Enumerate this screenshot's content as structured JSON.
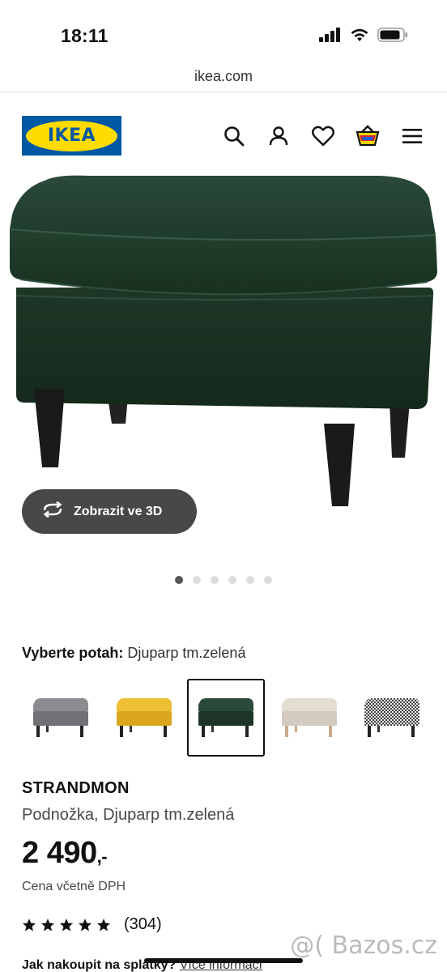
{
  "status_bar": {
    "time": "18:11",
    "icons": [
      "signal-icon",
      "wifi-icon",
      "battery-icon"
    ]
  },
  "browser": {
    "url": "ikea.com"
  },
  "header": {
    "logo_text": "IKEA",
    "icons": [
      "search-icon",
      "account-icon",
      "heart-icon",
      "cart-icon",
      "menu-icon"
    ]
  },
  "hero": {
    "view3d_label": "Zobrazit ve 3D",
    "dots_total": 6,
    "active_dot": 1
  },
  "fabric": {
    "label": "Vyberte potah:",
    "value": "Djuparp tm.zelená",
    "swatch_colors": [
      "#7d7f82",
      "#e7b52a",
      "#1f3a2c",
      "#ddd5c8",
      "#bdbdbd"
    ],
    "selected_index": 2
  },
  "product": {
    "name": "STRANDMON",
    "description": "Podnožka, Djuparp tm.zelená",
    "price": "2 490",
    "price_suffix": ",-",
    "vat_note": "Cena včetně DPH",
    "rating_stars": 5,
    "review_count": "(304)"
  },
  "installment": {
    "question": "Jak nakoupit na splátky?",
    "more": "Více informací"
  },
  "watermark": "@( Bazos.cz",
  "colors": {
    "ikea_blue": "#0058a3",
    "ikea_yellow": "#ffdb00",
    "fabric_green": "#1f3a2c",
    "button_dark": "#484848"
  }
}
